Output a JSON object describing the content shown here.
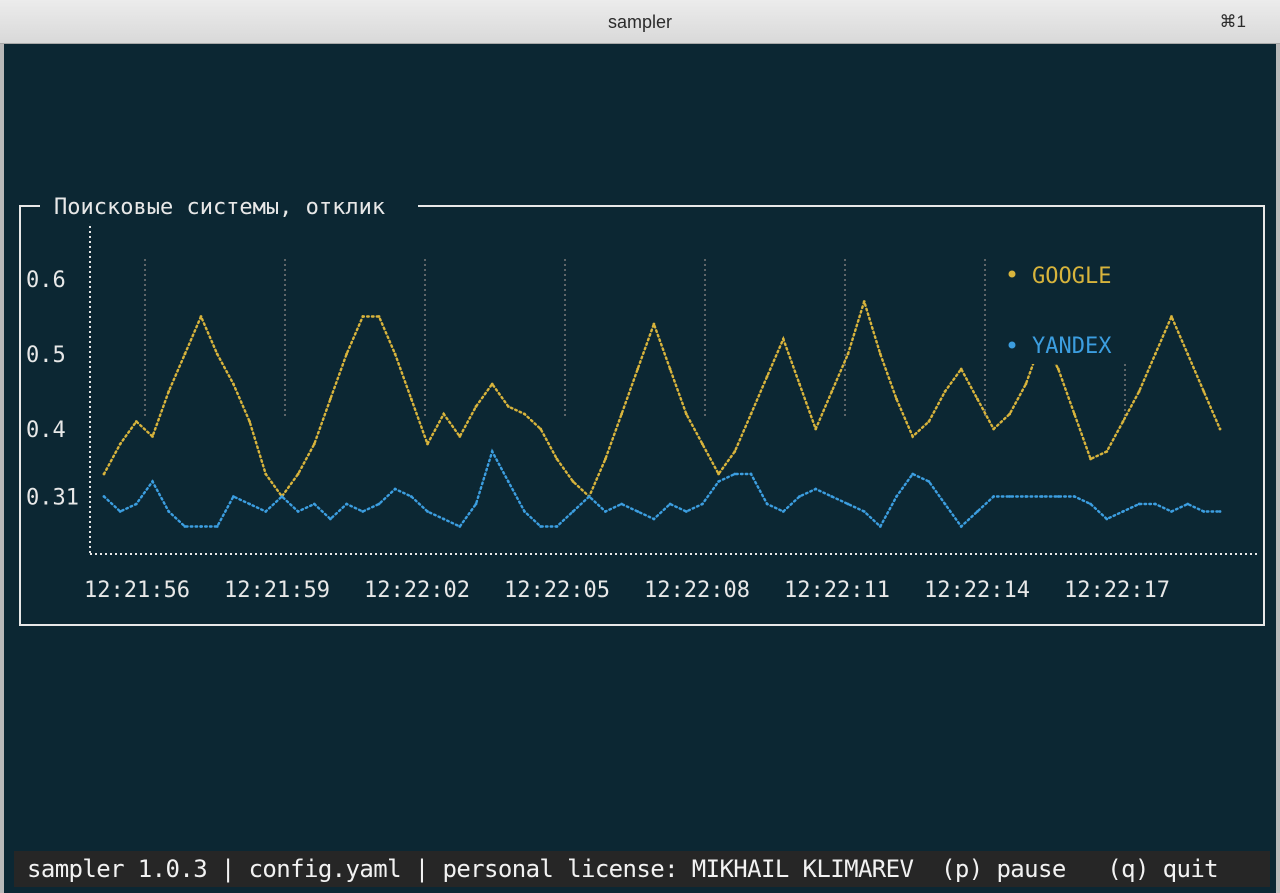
{
  "window": {
    "title": "sampler",
    "shortcut": "⌘1"
  },
  "statusbar": {
    "text": "sampler 1.0.3 | config.yaml | personal license: MIKHAIL KLIMAREV  (p) pause   (q) quit"
  },
  "colors": {
    "background": "#0c2733",
    "axis": "#e8e8e8",
    "google": "#d8b43c",
    "yandex": "#3c9ee0",
    "tick": "#7a7a7a"
  },
  "chart_data": {
    "type": "line",
    "title": "Поисковые системы, отклик",
    "y_ticks": [
      "0.6",
      "0.5",
      "0.4",
      "0.31"
    ],
    "x_ticks": [
      "12:21:56",
      "12:21:59",
      "12:22:02",
      "12:22:05",
      "12:22:08",
      "12:22:11",
      "12:22:14",
      "12:22:17"
    ],
    "ylim": [
      0.24,
      0.66
    ],
    "legend_position": "top-right",
    "series": [
      {
        "name": "GOOGLE",
        "color": "#d8b43c",
        "values": [
          0.34,
          0.38,
          0.41,
          0.39,
          0.45,
          0.5,
          0.55,
          0.5,
          0.46,
          0.41,
          0.34,
          0.31,
          0.34,
          0.38,
          0.44,
          0.5,
          0.55,
          0.55,
          0.5,
          0.44,
          0.38,
          0.42,
          0.39,
          0.43,
          0.46,
          0.43,
          0.42,
          0.4,
          0.36,
          0.33,
          0.31,
          0.36,
          0.42,
          0.48,
          0.54,
          0.48,
          0.42,
          0.38,
          0.34,
          0.37,
          0.42,
          0.47,
          0.52,
          0.46,
          0.4,
          0.45,
          0.5,
          0.57,
          0.5,
          0.44,
          0.39,
          0.41,
          0.45,
          0.48,
          0.44,
          0.4,
          0.42,
          0.46,
          0.52,
          0.48,
          0.42,
          0.36,
          0.37,
          0.41,
          0.45,
          0.5,
          0.55,
          0.5,
          0.45,
          0.4
        ]
      },
      {
        "name": "YANDEX",
        "color": "#3c9ee0",
        "values": [
          0.31,
          0.29,
          0.3,
          0.33,
          0.29,
          0.27,
          0.27,
          0.27,
          0.31,
          0.3,
          0.29,
          0.31,
          0.29,
          0.3,
          0.28,
          0.3,
          0.29,
          0.3,
          0.32,
          0.31,
          0.29,
          0.28,
          0.27,
          0.3,
          0.37,
          0.33,
          0.29,
          0.27,
          0.27,
          0.29,
          0.31,
          0.29,
          0.3,
          0.29,
          0.28,
          0.3,
          0.29,
          0.3,
          0.33,
          0.34,
          0.34,
          0.3,
          0.29,
          0.31,
          0.32,
          0.31,
          0.3,
          0.29,
          0.27,
          0.31,
          0.34,
          0.33,
          0.3,
          0.27,
          0.29,
          0.31,
          0.31,
          0.31,
          0.31,
          0.31,
          0.31,
          0.3,
          0.28,
          0.29,
          0.3,
          0.3,
          0.29,
          0.3,
          0.29,
          0.29
        ]
      }
    ]
  }
}
